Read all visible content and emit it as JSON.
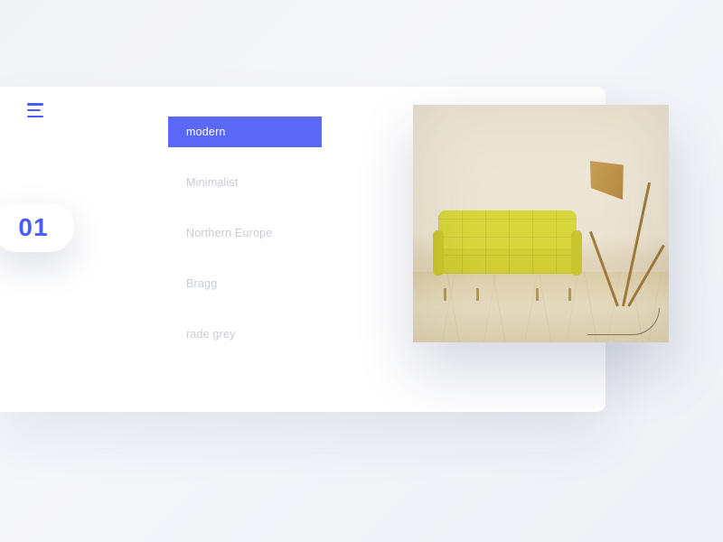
{
  "page": {
    "number": "01"
  },
  "styles": {
    "items": [
      {
        "label": "modern",
        "active": true
      },
      {
        "label": "Minimalist",
        "active": false
      },
      {
        "label": "Northern Europe",
        "active": false
      },
      {
        "label": "Bragg",
        "active": false
      },
      {
        "label": "rade grey",
        "active": false
      }
    ]
  },
  "colors": {
    "accent": "#5b68f5"
  },
  "product": {
    "name": "yellow-tufted-sofa-with-tripod-lamp"
  }
}
